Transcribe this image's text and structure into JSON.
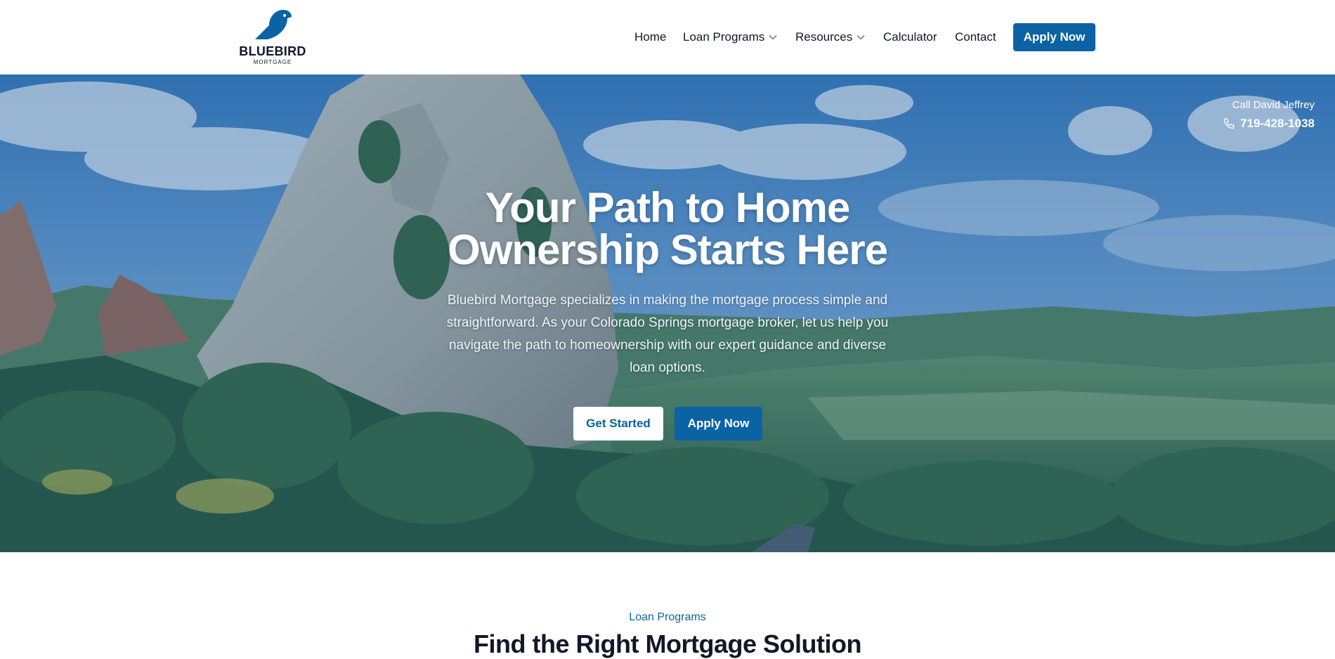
{
  "brand": {
    "name": "BLUEBIRD",
    "subtitle": "MORTGAGE",
    "icon": "bluebird-logo-icon",
    "color": "#0b63a4"
  },
  "nav": {
    "items": [
      {
        "label": "Home",
        "has_dropdown": false
      },
      {
        "label": "Loan Programs",
        "has_dropdown": true
      },
      {
        "label": "Resources",
        "has_dropdown": true
      },
      {
        "label": "Calculator",
        "has_dropdown": false
      },
      {
        "label": "Contact",
        "has_dropdown": false
      }
    ],
    "apply_label": "Apply Now"
  },
  "hero": {
    "call_label": "Call David Jeffrey",
    "phone": "719-428-1038",
    "phone_icon": "phone-icon",
    "title": "Your Path to Home Ownership Starts Here",
    "text": "Bluebird Mortgage specializes in making the mortgage process simple and straightforward. As your Colorado Springs mortgage broker, let us help you navigate the path to homeownership with our expert guidance and diverse loan options.",
    "get_started_label": "Get Started",
    "apply_label": "Apply Now",
    "background": "mountain-landscape-image",
    "overlay_color": "#0c4e91"
  },
  "section": {
    "eyebrow": "Loan Programs",
    "title": "Find the Right Mortgage Solution"
  }
}
